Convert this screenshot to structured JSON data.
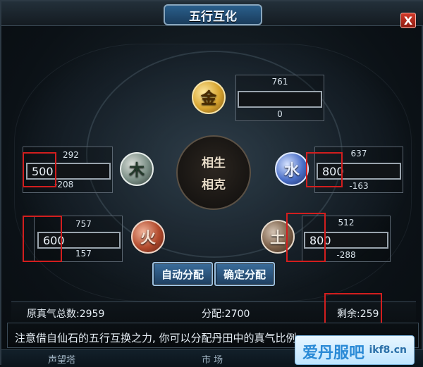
{
  "window": {
    "title": "五行互化",
    "close_label": "X"
  },
  "center": {
    "line1": "相生",
    "line2": "相克"
  },
  "elements": {
    "gold": {
      "icon_text": "金",
      "top": "761",
      "bar_value": "",
      "bottom": "0"
    },
    "wood": {
      "icon_text": "木",
      "top": "292",
      "bar_value": "500",
      "bottom": "-208"
    },
    "water": {
      "icon_text": "水",
      "top": "637",
      "bar_value": "800",
      "bottom": "-163"
    },
    "fire": {
      "icon_text": "火",
      "top": "757",
      "bar_value": "600",
      "bottom": "157"
    },
    "earth": {
      "icon_text": "土",
      "top": "512",
      "bar_value": "800",
      "bottom": "-288"
    }
  },
  "buttons": {
    "auto": "自动分配",
    "confirm": "确定分配"
  },
  "footer": {
    "total_label": "原真气总数:2959",
    "alloc_label": "分配:2700",
    "remain_label": "剩余:259"
  },
  "message": {
    "text": "注意借自仙石的五行互换之力, 你可以分配丹田中的真气比例"
  },
  "bottom_strip": {
    "left": "声望塔",
    "mid": "市 场"
  },
  "watermark": {
    "brand": "爱丹服吧",
    "domain": "ikf8.cn"
  },
  "colors": {
    "highlight_red": "#d21e1e",
    "button_blue": "#2a5f8c"
  }
}
